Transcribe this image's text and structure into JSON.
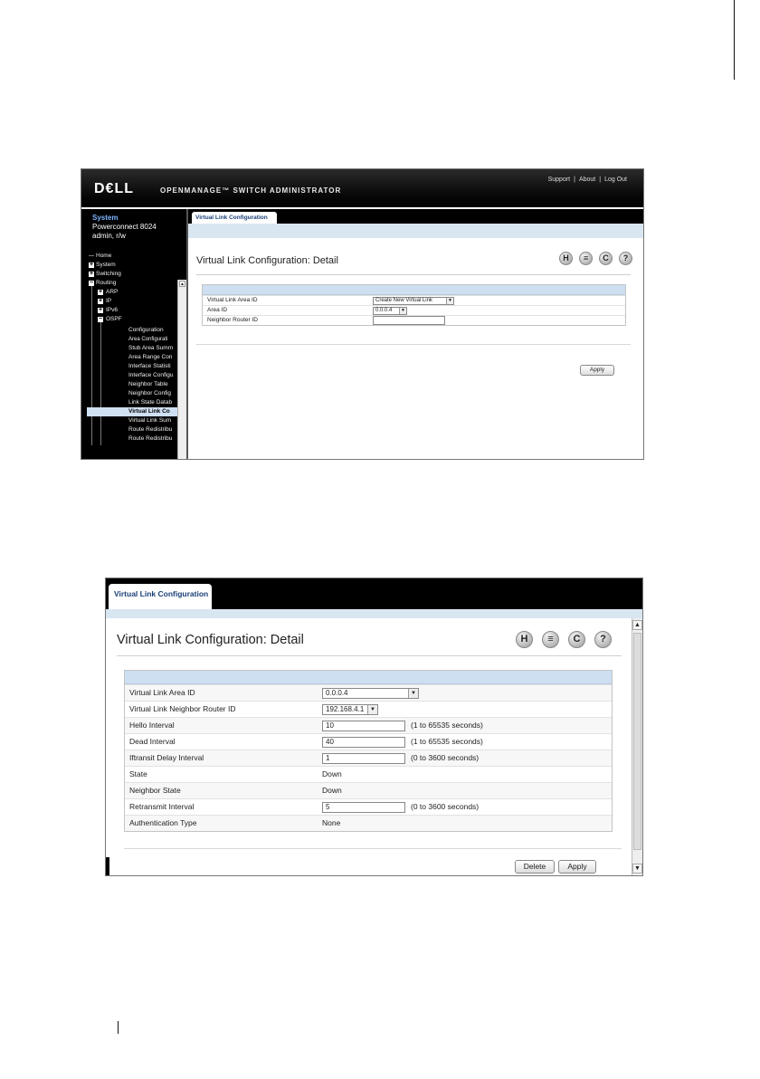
{
  "shot1": {
    "header": {
      "logo": "D€LL",
      "title": "OPENMANAGE™ SWITCH ADMINISTRATOR",
      "links": [
        "Support",
        "|",
        "About",
        "|",
        "Log Out"
      ]
    },
    "system": {
      "heading": "System",
      "model": "Powerconnect 8024",
      "user": "admin, r/w"
    },
    "tree": [
      "Home",
      "System",
      "Switching",
      "Routing",
      "ARP",
      "IP",
      "IPv6",
      "OSPF",
      "Configuration",
      "Area Configurati",
      "Stub Area Summ",
      "Area Range Con",
      "Interface Statisti",
      "Interface Configu",
      "Neighbor Table",
      "Neighbor Config",
      "Link State Datab",
      "Virtual Link Co",
      "Virtual Link Sum",
      "Route Redistribu",
      "Route Redistribu"
    ],
    "tab_label": "Virtual Link Configuration",
    "page_title": "Virtual Link Configuration: Detail",
    "rows": [
      {
        "label": "Virtual Link Area ID",
        "value": "Create New Virtual Link"
      },
      {
        "label": "Area ID",
        "value": "0.0.0.4"
      },
      {
        "label": "Neighbor Router ID",
        "value": ""
      }
    ],
    "apply_label": "Apply"
  },
  "shot2": {
    "tab_label": "Virtual Link Configuration",
    "page_title": "Virtual Link Configuration: Detail",
    "rows": [
      {
        "label": "Virtual Link Area ID",
        "value": "0.0.0.4",
        "range": ""
      },
      {
        "label": "Virtual Link Neighbor Router ID",
        "value": "192.168.4.1",
        "range": ""
      },
      {
        "label": "Hello Interval",
        "value": "10",
        "range": "(1 to 65535 seconds)"
      },
      {
        "label": "Dead Interval",
        "value": "40",
        "range": "(1 to 65535 seconds)"
      },
      {
        "label": "Iftransit Delay Interval",
        "value": "1",
        "range": "(0 to 3600 seconds)"
      },
      {
        "label": "State",
        "value": "Down",
        "range": ""
      },
      {
        "label": "Neighbor State",
        "value": "Down",
        "range": ""
      },
      {
        "label": "Retransmit Interval",
        "value": "5",
        "range": "(0 to 3600 seconds)"
      },
      {
        "label": "Authentication Type",
        "value": "None",
        "range": ""
      }
    ],
    "delete_label": "Delete",
    "apply_label": "Apply"
  },
  "icons": [
    "save-icon",
    "print-icon",
    "refresh-icon",
    "help-icon"
  ],
  "icon_glyphs": {
    "save": "H",
    "print": "≡",
    "refresh": "C",
    "help": "?"
  }
}
